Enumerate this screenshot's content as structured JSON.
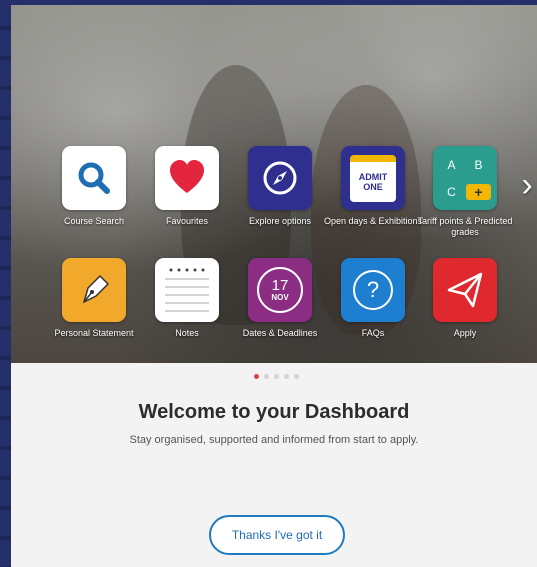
{
  "tiles_row1": [
    {
      "label": "Course Search",
      "icon": "search-icon",
      "bg": "#ffffff"
    },
    {
      "label": "Favourites",
      "icon": "heart-icon",
      "bg": "#ffffff"
    },
    {
      "label": "Explore options",
      "icon": "compass-icon",
      "bg": "#2e2f8f"
    },
    {
      "label": "Open days & Exhibitions",
      "icon": "ticket-icon",
      "bg": "#2e2f8f"
    },
    {
      "label": "Tariff points & Predicted grades",
      "icon": "grades-grid-icon",
      "bg": "#2a9d8f"
    }
  ],
  "tiles_row2": [
    {
      "label": "Personal Statement",
      "icon": "pen-icon",
      "bg": "#f2a82a"
    },
    {
      "label": "Notes",
      "icon": "notepad-icon",
      "bg": "#ffffff"
    },
    {
      "label": "Dates & Deadlines",
      "icon": "calendar-icon",
      "bg": "#8a2d83"
    },
    {
      "label": "FAQs",
      "icon": "question-icon",
      "bg": "#1e7fd0"
    },
    {
      "label": "Apply",
      "icon": "paper-plane-icon",
      "bg": "#e0292e"
    }
  ],
  "ticket": {
    "line1": "ADMIT",
    "line2": "ONE"
  },
  "grades": {
    "a": "A",
    "b": "B",
    "c": "C",
    "plus": "+"
  },
  "calendar": {
    "day": "17",
    "month": "NOV"
  },
  "faq_symbol": "?",
  "next_arrow": "›",
  "dashboard": {
    "title": "Welcome to your Dashboard",
    "subtitle": "Stay organised, supported and informed from start to apply.",
    "button": "Thanks I've got it"
  },
  "pagination": {
    "count": 5,
    "active": 0
  },
  "colors": {
    "accent_blue": "#1f7bbd",
    "dot_active": "#e04040"
  }
}
